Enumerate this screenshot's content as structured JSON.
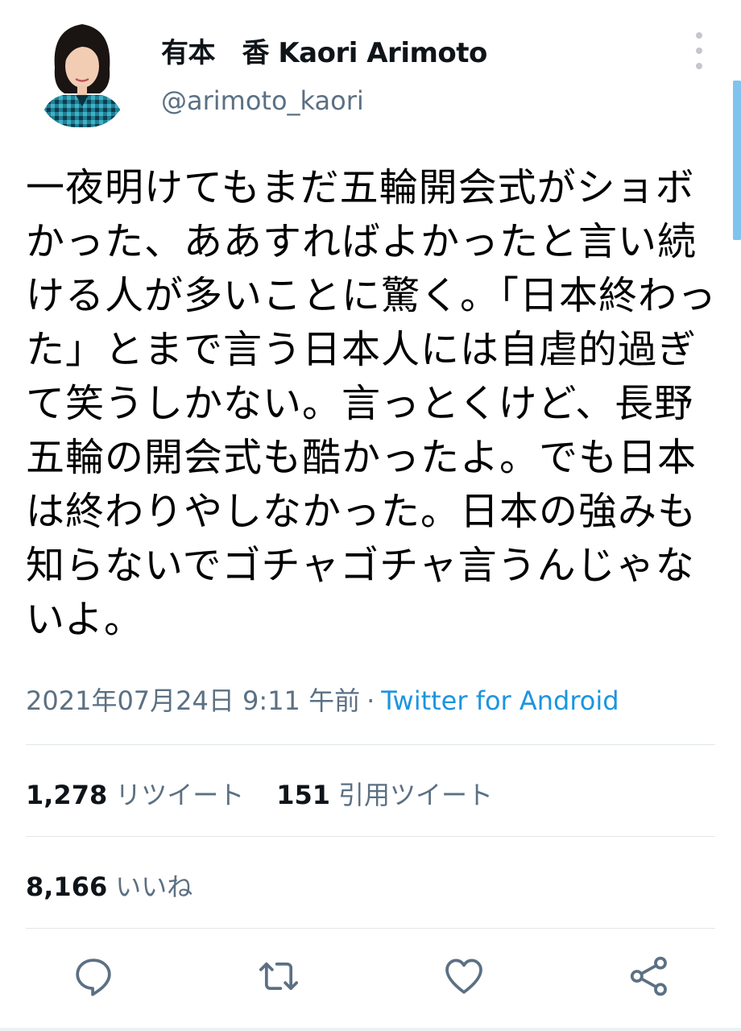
{
  "author": {
    "display_name": "有本　香 Kaori Arimoto",
    "handle": "@arimoto_kaori"
  },
  "tweet": {
    "text": "一夜明けてもまだ五輪開会式がショボかった、ああすればよかったと言い続ける人が多いことに驚く。「日本終わった」とまで言う日本人には自虐的過ぎて笑うしかない。言っとくけど、長野五輪の開会式も酷かったよ。でも日本は終わりやしなかった。日本の強みも知らないでゴチャゴチャ言うんじゃないよ。",
    "timestamp": "2021年07月24日 9:11 午前",
    "separator": "·",
    "source": "Twitter for Android"
  },
  "stats": {
    "retweets": "1,278",
    "retweets_label": "リツイート",
    "quotes": "151",
    "quotes_label": "引用ツイート",
    "likes": "8,166",
    "likes_label": "いいね"
  },
  "icons": {
    "more": "more-vertical-icon",
    "reply": "reply-icon",
    "retweet": "retweet-icon",
    "like": "heart-icon",
    "share": "share-icon"
  },
  "colors": {
    "link": "#1b95e0",
    "secondary_text": "#5b7083",
    "icon": "#5b7083"
  }
}
